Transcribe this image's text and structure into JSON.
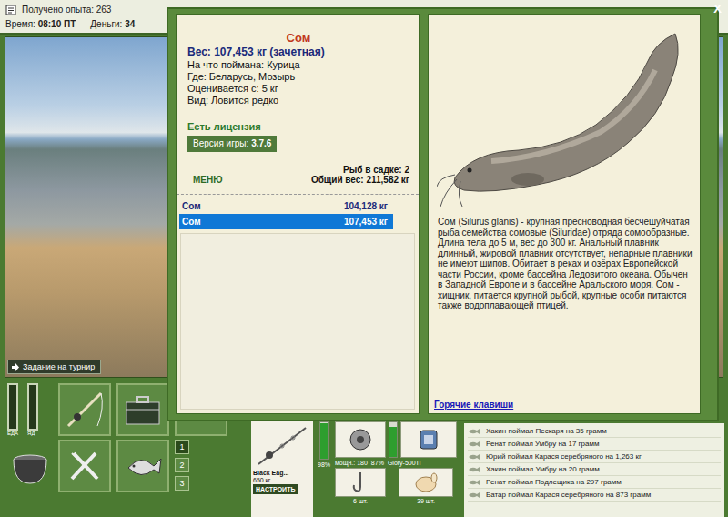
{
  "status_bar": {
    "experience": "Получено опыта: 263",
    "time_label": "Время:",
    "time": "08:10 ПТ",
    "money_label": "Деньги:",
    "money": "34"
  },
  "scene": {
    "tournament_button": "Задание на турнир"
  },
  "controls": {
    "bars": [
      {
        "label": "ЕДА",
        "level": 0
      },
      {
        "label": "ЯД",
        "level": 0
      }
    ],
    "slots": [
      {
        "label": "1",
        "selected": true
      },
      {
        "label": "2",
        "selected": false
      },
      {
        "label": "3",
        "selected": false
      }
    ]
  },
  "tackle": {
    "rod": {
      "name": "Black Eag...",
      "strength": "650 кг",
      "wear": "98%",
      "level": 0.98,
      "button": "НАСТРОИТЬ"
    },
    "reel": {
      "power": "мощн.: 180",
      "wear": "87%",
      "level": 0.87
    },
    "line": {
      "name": "Glory-500Ti"
    },
    "hook": {
      "count": "6 шт."
    },
    "bait": {
      "count": "39 шт."
    }
  },
  "chat": [
    "Хакин поймал Пескаря на 35 грамм",
    "Ренат поймал Умбру на 17 грамм",
    "Юрий поймал Карася серебряного на 1,263 кг",
    "Хакин поймал Умбру на 20 грамм",
    "Ренат поймал Подлещика на 297 грамм",
    "Батар поймал Карася серебряного на 873 грамм"
  ],
  "dialog": {
    "close": "X",
    "fish": "Сом",
    "weight": "Вес: 107,453 кг (зачетная)",
    "details": [
      "На что поймана: Курица",
      "Где: Беларусь, Мозырь",
      "Оценивается с: 5 кг",
      "Вид: Ловится редко"
    ],
    "license": "Есть лицензия",
    "version_label": "Версия игры:",
    "version": "3.7.6",
    "menu": "МЕНЮ",
    "net_count": "Рыб в садке: 2",
    "total_weight": "Общий вес: 211,582 кг",
    "catches": [
      {
        "name": "Сом",
        "weight": "104,128 кг",
        "selected": false
      },
      {
        "name": "Сом",
        "weight": "107,453 кг",
        "selected": true
      }
    ],
    "description": "Сом (Silurus glanis) - крупная пресноводная бесчешуйчатая рыба семейства сомовые (Siluridae) отряда сомообразные. Длина тела до 5 м, вес до 300 кг. Анальный плавник длинный, жировой плавник отсутствует, непарные плавники не имеют шипов. Обитает в реках и озёрах Европейской части России, кроме бассейна Ледовитого океана. Обычен в Западной Европе и в бассейне Аральского моря. Сом - хищник, питается крупной рыбой, крупные особи питаются также водоплавающей птицей.",
    "hotkeys": "Горячие клавиши"
  }
}
